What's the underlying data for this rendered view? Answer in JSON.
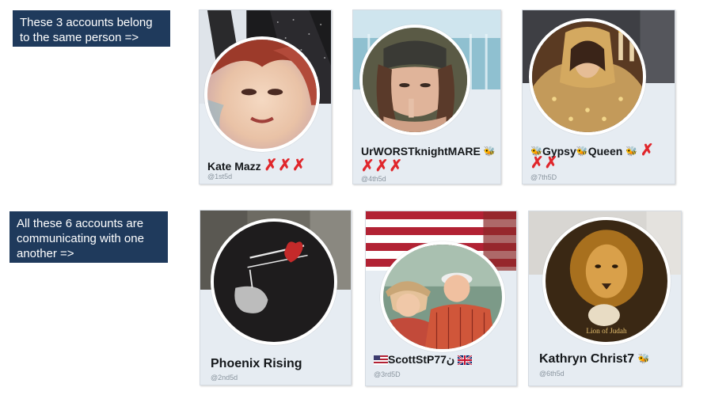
{
  "callouts": {
    "same_person": "These 3 accounts belong to the same person =>",
    "communicating": "All these 6 accounts are communicating with one another =>"
  },
  "accounts": [
    {
      "name": "Kate Mazz",
      "handle": "@1st5d",
      "marks": "✗✗✗"
    },
    {
      "name": "UrWORSTknightMARE",
      "handle": "@4th5d",
      "marks": "✗✗✗",
      "icon": "bee-icon"
    },
    {
      "name_parts": [
        "Gypsy",
        "Queen"
      ],
      "handle": "@7th5D",
      "marks_line1": "✗",
      "marks_line2": "✗✗",
      "icon": "bee-icon"
    },
    {
      "name": "Phoenix Rising",
      "handle": "@2nd5d"
    },
    {
      "name": "ScottStP77",
      "suffix": "ن",
      "handle": "@3rd5D",
      "icons": [
        "us-flag-icon",
        "uk-flag-icon"
      ]
    },
    {
      "name": "Kathryn Christ7",
      "handle": "@6th5d",
      "icon": "bee-icon"
    }
  ],
  "image_text": {
    "lion_caption": "Lion of Judah"
  },
  "colors": {
    "callout_bg": "#1f3a5c",
    "x_mark": "#e0262b",
    "card_bg": "#e6ecf2",
    "handle": "#8a959f"
  }
}
